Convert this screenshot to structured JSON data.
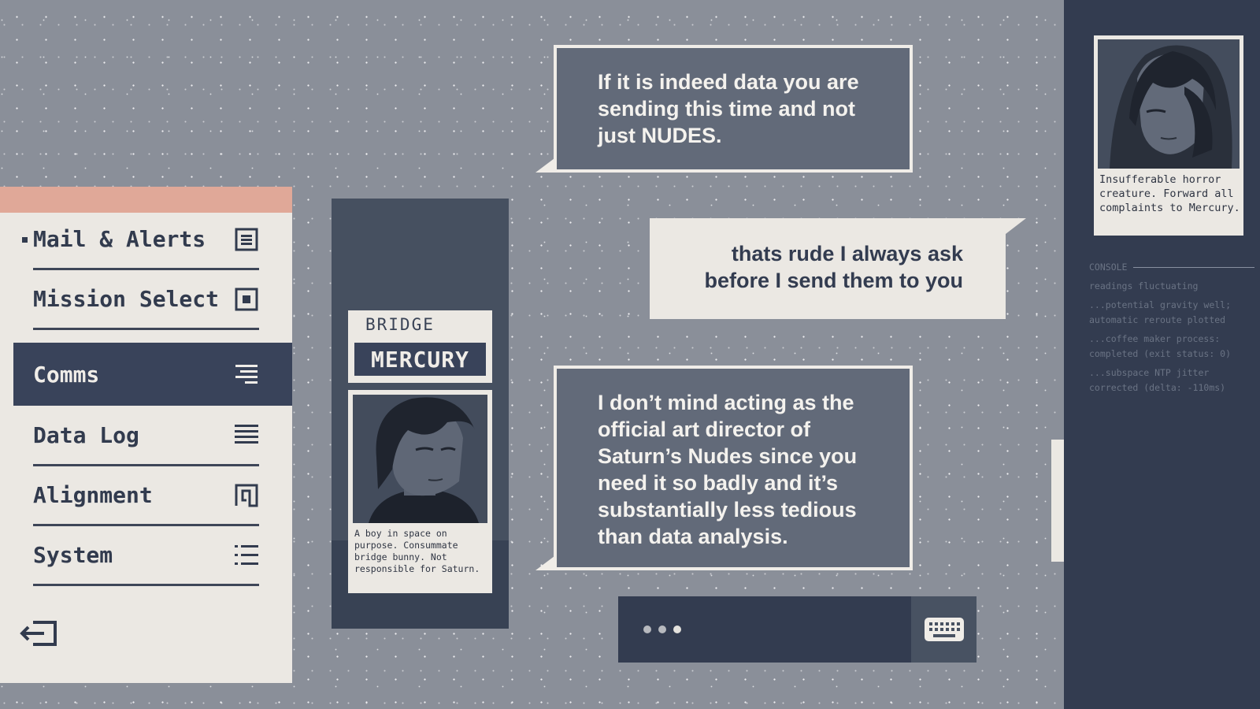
{
  "menu": {
    "items": [
      {
        "label": "Mail & Alerts",
        "icon": "mail-alerts-icon"
      },
      {
        "label": "Mission Select",
        "icon": "mission-select-icon"
      },
      {
        "label": "Comms",
        "icon": "comms-icon",
        "active": true
      },
      {
        "label": "Data Log",
        "icon": "data-log-icon"
      },
      {
        "label": "Alignment",
        "icon": "alignment-icon"
      },
      {
        "label": "System",
        "icon": "system-icon"
      }
    ],
    "exit_icon": "exit-icon"
  },
  "character": {
    "location": "BRIDGE",
    "name": "MERCURY",
    "caption": "A boy in space on purpose. Consummate bridge bunny. Not responsible for Saturn."
  },
  "messages": [
    {
      "side": "incoming",
      "text": "If it is indeed data you are sending this time and not just NUDES."
    },
    {
      "side": "outgoing",
      "text": "thats rude I always ask before I send them to you"
    },
    {
      "side": "incoming",
      "text": "I don’t mind acting as the official art director of Saturn’s Nudes since you need it so badly and it’s substantially less tedious than data analysis."
    }
  ],
  "input": {
    "typing_dots": 3,
    "keyboard_icon": "keyboard-icon"
  },
  "profile": {
    "caption": "Insufferable horror creature. Forward all complaints to Mercury."
  },
  "console": {
    "title": "CONSOLE",
    "lines": [
      "readings fluctuating",
      "...potential gravity well; automatic reroute plotted",
      "...coffee maker process: completed (exit status: 0)",
      "...subspace NTP jitter corrected (delta: -110ms)"
    ]
  },
  "colors": {
    "background": "#8a8f99",
    "panel_dark": "#333c50",
    "menu_bg": "#ebe8e3",
    "menu_accent": "#e0a898",
    "bubble_dark": "#626a79"
  }
}
